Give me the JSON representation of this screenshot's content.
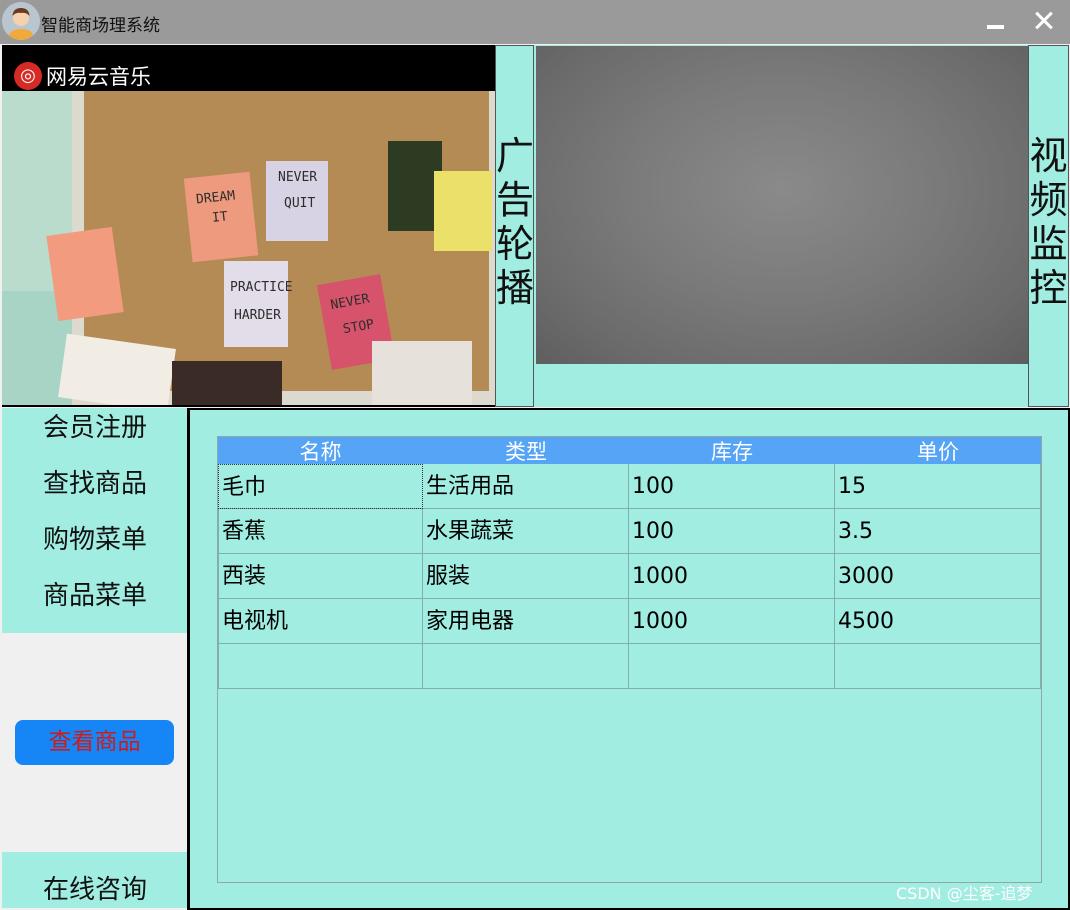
{
  "window": {
    "title": "智能商场理系统"
  },
  "ad": {
    "logo_text": "网易云音乐",
    "label": "广告轮播"
  },
  "camera": {
    "label": "视频监控"
  },
  "menu": {
    "items": [
      "会员注册",
      "查找商品",
      "购物菜单",
      "商品菜单"
    ],
    "view_button": "查看商品",
    "consult": "在线咨询"
  },
  "table": {
    "headers": [
      "名称",
      "类型",
      "库存",
      "单价"
    ],
    "rows": [
      [
        "毛巾",
        "生活用品",
        "100",
        "15"
      ],
      [
        "香蕉",
        "水果蔬菜",
        "100",
        "3.5"
      ],
      [
        "西装",
        "服装",
        "1000",
        "3000"
      ],
      [
        "电视机",
        "家用电器",
        "1000",
        "4500"
      ],
      [
        "",
        "",
        "",
        ""
      ]
    ]
  },
  "watermark": "CSDN @尘客-追梦",
  "colors": {
    "accent": "#1685f5",
    "panel": "#a2ede1",
    "header": "#56a4f5"
  }
}
